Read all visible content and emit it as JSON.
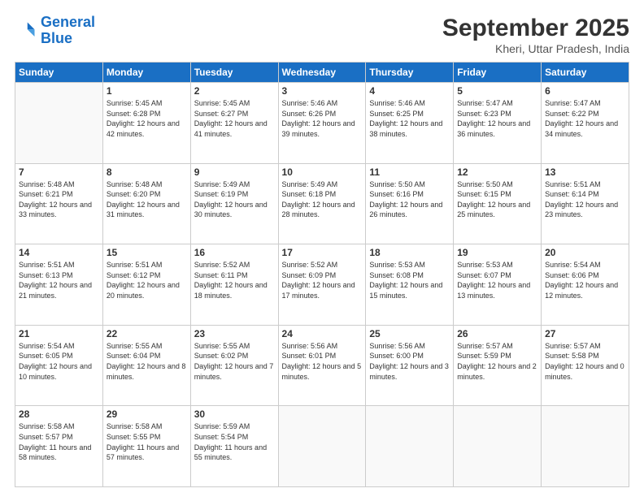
{
  "header": {
    "logo_general": "General",
    "logo_blue": "Blue",
    "month": "September 2025",
    "location": "Kheri, Uttar Pradesh, India"
  },
  "weekdays": [
    "Sunday",
    "Monday",
    "Tuesday",
    "Wednesday",
    "Thursday",
    "Friday",
    "Saturday"
  ],
  "weeks": [
    [
      {
        "day": "",
        "sunrise": "",
        "sunset": "",
        "daylight": ""
      },
      {
        "day": "1",
        "sunrise": "Sunrise: 5:45 AM",
        "sunset": "Sunset: 6:28 PM",
        "daylight": "Daylight: 12 hours and 42 minutes."
      },
      {
        "day": "2",
        "sunrise": "Sunrise: 5:45 AM",
        "sunset": "Sunset: 6:27 PM",
        "daylight": "Daylight: 12 hours and 41 minutes."
      },
      {
        "day": "3",
        "sunrise": "Sunrise: 5:46 AM",
        "sunset": "Sunset: 6:26 PM",
        "daylight": "Daylight: 12 hours and 39 minutes."
      },
      {
        "day": "4",
        "sunrise": "Sunrise: 5:46 AM",
        "sunset": "Sunset: 6:25 PM",
        "daylight": "Daylight: 12 hours and 38 minutes."
      },
      {
        "day": "5",
        "sunrise": "Sunrise: 5:47 AM",
        "sunset": "Sunset: 6:23 PM",
        "daylight": "Daylight: 12 hours and 36 minutes."
      },
      {
        "day": "6",
        "sunrise": "Sunrise: 5:47 AM",
        "sunset": "Sunset: 6:22 PM",
        "daylight": "Daylight: 12 hours and 34 minutes."
      }
    ],
    [
      {
        "day": "7",
        "sunrise": "Sunrise: 5:48 AM",
        "sunset": "Sunset: 6:21 PM",
        "daylight": "Daylight: 12 hours and 33 minutes."
      },
      {
        "day": "8",
        "sunrise": "Sunrise: 5:48 AM",
        "sunset": "Sunset: 6:20 PM",
        "daylight": "Daylight: 12 hours and 31 minutes."
      },
      {
        "day": "9",
        "sunrise": "Sunrise: 5:49 AM",
        "sunset": "Sunset: 6:19 PM",
        "daylight": "Daylight: 12 hours and 30 minutes."
      },
      {
        "day": "10",
        "sunrise": "Sunrise: 5:49 AM",
        "sunset": "Sunset: 6:18 PM",
        "daylight": "Daylight: 12 hours and 28 minutes."
      },
      {
        "day": "11",
        "sunrise": "Sunrise: 5:50 AM",
        "sunset": "Sunset: 6:16 PM",
        "daylight": "Daylight: 12 hours and 26 minutes."
      },
      {
        "day": "12",
        "sunrise": "Sunrise: 5:50 AM",
        "sunset": "Sunset: 6:15 PM",
        "daylight": "Daylight: 12 hours and 25 minutes."
      },
      {
        "day": "13",
        "sunrise": "Sunrise: 5:51 AM",
        "sunset": "Sunset: 6:14 PM",
        "daylight": "Daylight: 12 hours and 23 minutes."
      }
    ],
    [
      {
        "day": "14",
        "sunrise": "Sunrise: 5:51 AM",
        "sunset": "Sunset: 6:13 PM",
        "daylight": "Daylight: 12 hours and 21 minutes."
      },
      {
        "day": "15",
        "sunrise": "Sunrise: 5:51 AM",
        "sunset": "Sunset: 6:12 PM",
        "daylight": "Daylight: 12 hours and 20 minutes."
      },
      {
        "day": "16",
        "sunrise": "Sunrise: 5:52 AM",
        "sunset": "Sunset: 6:11 PM",
        "daylight": "Daylight: 12 hours and 18 minutes."
      },
      {
        "day": "17",
        "sunrise": "Sunrise: 5:52 AM",
        "sunset": "Sunset: 6:09 PM",
        "daylight": "Daylight: 12 hours and 17 minutes."
      },
      {
        "day": "18",
        "sunrise": "Sunrise: 5:53 AM",
        "sunset": "Sunset: 6:08 PM",
        "daylight": "Daylight: 12 hours and 15 minutes."
      },
      {
        "day": "19",
        "sunrise": "Sunrise: 5:53 AM",
        "sunset": "Sunset: 6:07 PM",
        "daylight": "Daylight: 12 hours and 13 minutes."
      },
      {
        "day": "20",
        "sunrise": "Sunrise: 5:54 AM",
        "sunset": "Sunset: 6:06 PM",
        "daylight": "Daylight: 12 hours and 12 minutes."
      }
    ],
    [
      {
        "day": "21",
        "sunrise": "Sunrise: 5:54 AM",
        "sunset": "Sunset: 6:05 PM",
        "daylight": "Daylight: 12 hours and 10 minutes."
      },
      {
        "day": "22",
        "sunrise": "Sunrise: 5:55 AM",
        "sunset": "Sunset: 6:04 PM",
        "daylight": "Daylight: 12 hours and 8 minutes."
      },
      {
        "day": "23",
        "sunrise": "Sunrise: 5:55 AM",
        "sunset": "Sunset: 6:02 PM",
        "daylight": "Daylight: 12 hours and 7 minutes."
      },
      {
        "day": "24",
        "sunrise": "Sunrise: 5:56 AM",
        "sunset": "Sunset: 6:01 PM",
        "daylight": "Daylight: 12 hours and 5 minutes."
      },
      {
        "day": "25",
        "sunrise": "Sunrise: 5:56 AM",
        "sunset": "Sunset: 6:00 PM",
        "daylight": "Daylight: 12 hours and 3 minutes."
      },
      {
        "day": "26",
        "sunrise": "Sunrise: 5:57 AM",
        "sunset": "Sunset: 5:59 PM",
        "daylight": "Daylight: 12 hours and 2 minutes."
      },
      {
        "day": "27",
        "sunrise": "Sunrise: 5:57 AM",
        "sunset": "Sunset: 5:58 PM",
        "daylight": "Daylight: 12 hours and 0 minutes."
      }
    ],
    [
      {
        "day": "28",
        "sunrise": "Sunrise: 5:58 AM",
        "sunset": "Sunset: 5:57 PM",
        "daylight": "Daylight: 11 hours and 58 minutes."
      },
      {
        "day": "29",
        "sunrise": "Sunrise: 5:58 AM",
        "sunset": "Sunset: 5:55 PM",
        "daylight": "Daylight: 11 hours and 57 minutes."
      },
      {
        "day": "30",
        "sunrise": "Sunrise: 5:59 AM",
        "sunset": "Sunset: 5:54 PM",
        "daylight": "Daylight: 11 hours and 55 minutes."
      },
      {
        "day": "",
        "sunrise": "",
        "sunset": "",
        "daylight": ""
      },
      {
        "day": "",
        "sunrise": "",
        "sunset": "",
        "daylight": ""
      },
      {
        "day": "",
        "sunrise": "",
        "sunset": "",
        "daylight": ""
      },
      {
        "day": "",
        "sunrise": "",
        "sunset": "",
        "daylight": ""
      }
    ]
  ]
}
